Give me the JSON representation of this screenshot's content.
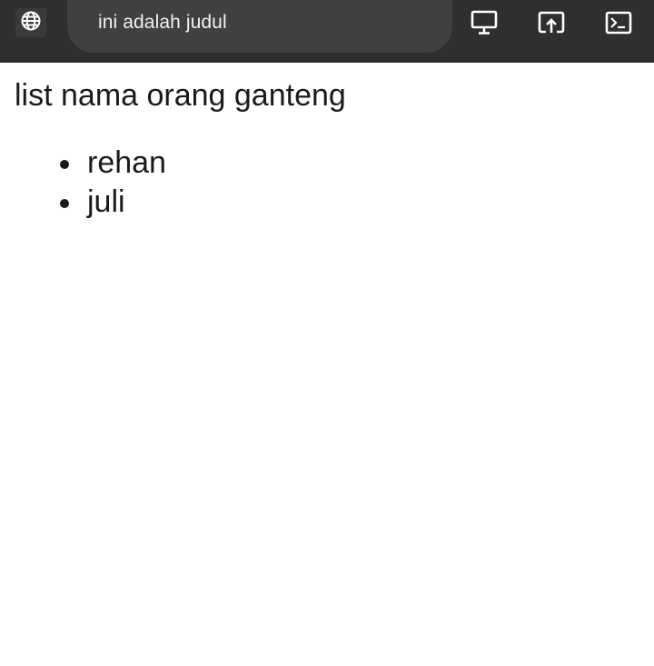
{
  "browser": {
    "tab_title": "ini adalah judul",
    "icons": {
      "site": "globe-icon",
      "desktop_view": "monitor-icon",
      "open_external": "open-in-new-icon",
      "console": "terminal-icon"
    }
  },
  "page": {
    "heading": "list nama orang ganteng",
    "names": [
      "rehan",
      "juli"
    ]
  }
}
